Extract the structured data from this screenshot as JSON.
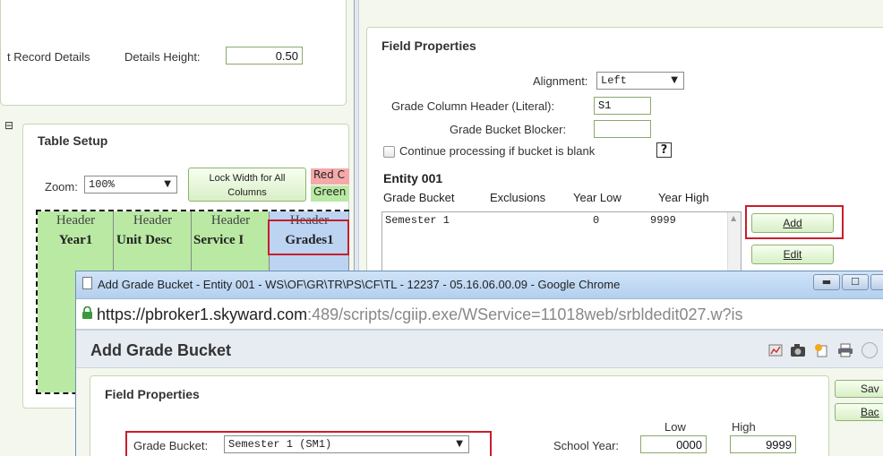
{
  "background": {
    "record_details_label": "t Record Details",
    "details_height_label": "Details Height:",
    "details_height_value": "0.50",
    "table_setup": {
      "title": "Table Setup",
      "zoom_label": "Zoom:",
      "zoom_value": "100%",
      "lock_width_button": "Lock Width for All Columns",
      "legend_red": "Red C",
      "legend_green": "Green",
      "columns": [
        {
          "header": "Header",
          "name": "Year1"
        },
        {
          "header": "Header",
          "name": "Unit Desc"
        },
        {
          "header": "Header",
          "name": "Service I"
        },
        {
          "header": "Header",
          "name": "Grades1"
        }
      ]
    }
  },
  "field_properties": {
    "title": "Field Properties",
    "alignment_label": "Alignment:",
    "alignment_value": "Left",
    "grade_column_header_label": "Grade Column Header (Literal):",
    "grade_column_header_value": "S1",
    "grade_bucket_blocker_label": "Grade Bucket Blocker:",
    "grade_bucket_blocker_value": "",
    "continue_processing_label": "Continue processing if bucket is blank",
    "help_label": "?",
    "entity_title": "Entity 001",
    "list_headers": [
      "Grade Bucket",
      "Exclusions",
      "Year Low",
      "Year High"
    ],
    "list_rows": [
      {
        "bucket": "Semester 1",
        "exclusions": "",
        "low": "0",
        "high": "9999"
      }
    ],
    "add_button": "Add",
    "edit_button": "Edit"
  },
  "popup": {
    "window_title": "Add Grade Bucket - Entity 001 - WS\\OF\\GR\\TR\\PS\\CF\\TL - 12237 - 05.16.06.00.09 - Google Chrome",
    "url_host": "https://pbroker1.skyward.com",
    "url_path": ":489/scripts/cgiip.exe/WService=11018web/srbldedit027.w?is",
    "page_title": "Add Grade Bucket",
    "field_properties_title": "Field Properties",
    "low_label": "Low",
    "high_label": "High",
    "grade_bucket_label": "Grade Bucket:",
    "grade_bucket_value": "Semester 1 (SM1)",
    "school_year_label": "School Year:",
    "school_year_low": "0000",
    "school_year_high": "9999",
    "save_button": "Sav",
    "back_button": "Bac"
  },
  "colors": {
    "accent_green": "#8fb36f",
    "highlight_red": "#c81e2b",
    "header_green": "#b9e9a3",
    "selected_column": "#bcd3f2"
  }
}
